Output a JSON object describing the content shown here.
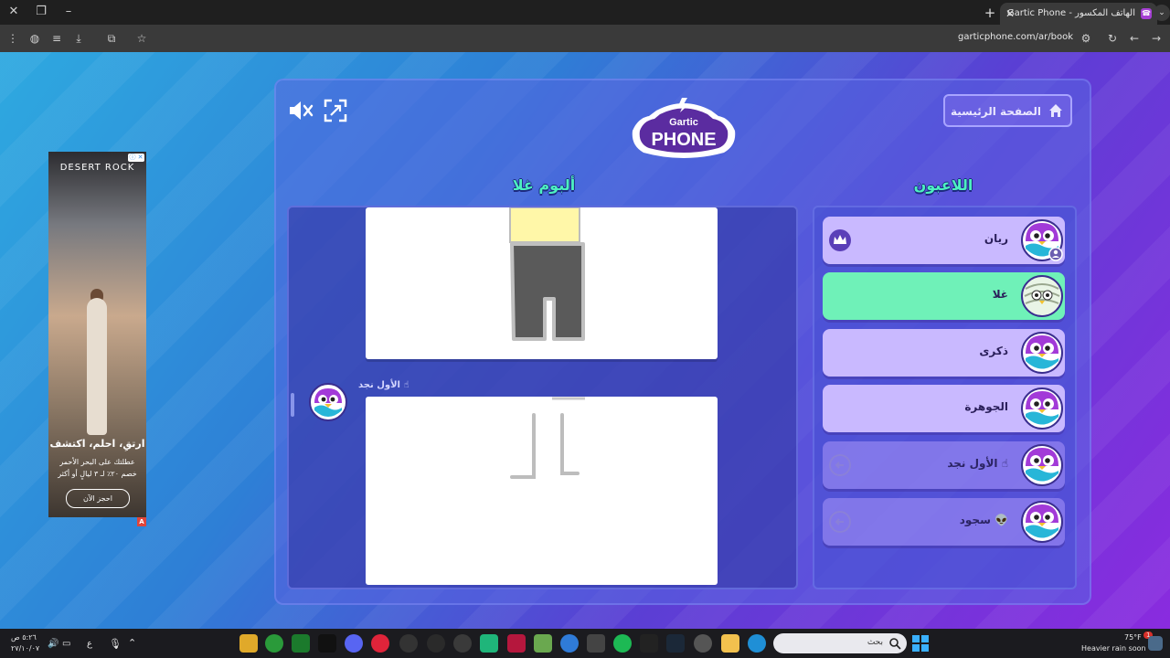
{
  "browser": {
    "tab_title": "Gartic Phone - الهاتف المكسور",
    "tab_close": "✕",
    "new_tab": "+",
    "url": "garticphone.com/ar/book"
  },
  "ad": {
    "brand": "DESERT ROCK",
    "adchoice": "ⓘ ✕",
    "headline": "ارتقِ، احلم، اكتشف",
    "sub": "عطلتك على البحر الأحمر خصم ٢٠٪ لـ ٣ ليالٍ أو أكثر",
    "cta": "احجز الآن",
    "badge": "A"
  },
  "game": {
    "logo_top": "Gartic",
    "logo_bottom": "PHONE",
    "home_label": "الصفحة الرئيسية",
    "album_title": "ألبوم غلا",
    "players_title": "اللاعبون",
    "album_author": "الأول نجد ☝"
  },
  "players": [
    {
      "name": "ريان",
      "state": "normal",
      "badge": "crown"
    },
    {
      "name": "غلا",
      "state": "active",
      "badge": ""
    },
    {
      "name": "ذكرى",
      "state": "normal",
      "badge": ""
    },
    {
      "name": "الجوهرة",
      "state": "normal",
      "badge": ""
    },
    {
      "name": "الأول نجد ☝",
      "state": "faded",
      "badge": "left"
    },
    {
      "name": "سجود 👽",
      "state": "faded",
      "badge": "left"
    }
  ],
  "taskbar": {
    "time": "٥:٢٦ ص",
    "date": "٢٧/١٠/٠٧",
    "lang": "ع",
    "search_placeholder": "بحث",
    "weather_temp": "75°F",
    "weather_desc": "Heavier rain soon",
    "notif_count": "1"
  },
  "colors": {
    "active_player": "#6ff1b8",
    "player": "#c9b9ff",
    "title_accent": "#4df0c0"
  }
}
